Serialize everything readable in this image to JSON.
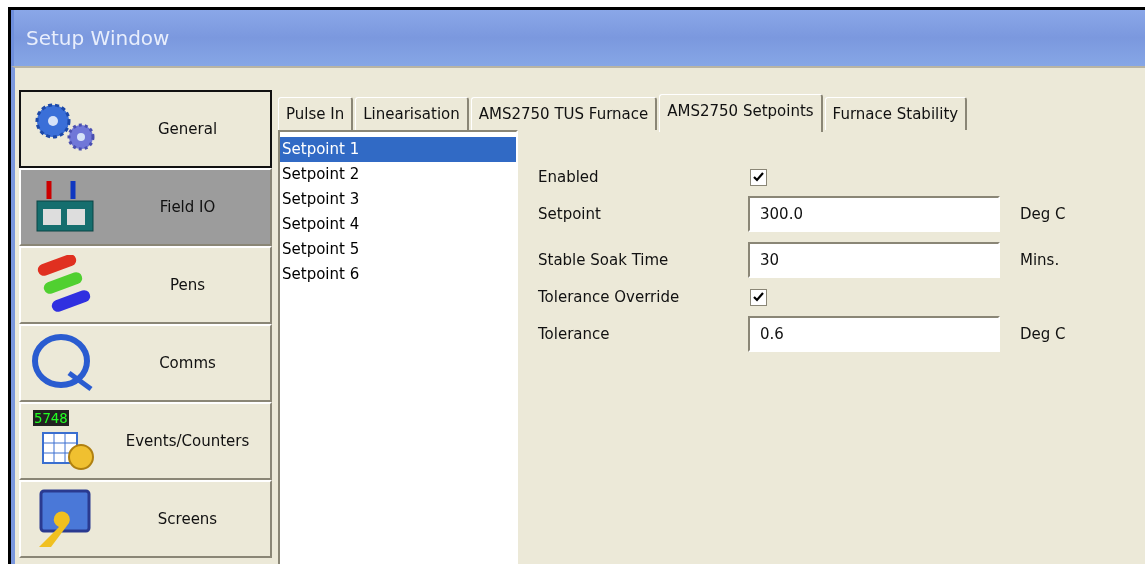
{
  "window": {
    "title": "Setup Window"
  },
  "sidebar": {
    "items": [
      {
        "label": "General",
        "kind": "gears",
        "selected": false,
        "focused": true
      },
      {
        "label": "Field IO",
        "kind": "terminals",
        "selected": true,
        "focused": false
      },
      {
        "label": "Pens",
        "kind": "pens",
        "selected": false,
        "focused": false
      },
      {
        "label": "Comms",
        "kind": "cable",
        "selected": false,
        "focused": false
      },
      {
        "label": "Events/Counters",
        "kind": "counter",
        "badge": "5748",
        "selected": false,
        "focused": false
      },
      {
        "label": "Screens",
        "kind": "monitor",
        "selected": false,
        "focused": false
      }
    ]
  },
  "tabs": [
    {
      "label": "Pulse In",
      "selected": false
    },
    {
      "label": "Linearisation",
      "selected": false
    },
    {
      "label": "AMS2750 TUS Furnace",
      "selected": false
    },
    {
      "label": "AMS2750 Setpoints",
      "selected": true
    },
    {
      "label": "Furnace Stability",
      "selected": false
    }
  ],
  "setpoint_list": [
    {
      "label": "Setpoint 1",
      "selected": true
    },
    {
      "label": "Setpoint 2",
      "selected": false
    },
    {
      "label": "Setpoint 3",
      "selected": false
    },
    {
      "label": "Setpoint 4",
      "selected": false
    },
    {
      "label": "Setpoint 5",
      "selected": false
    },
    {
      "label": "Setpoint 6",
      "selected": false
    }
  ],
  "form": [
    {
      "kind": "checkbox",
      "label": "Enabled",
      "checked": true
    },
    {
      "kind": "input",
      "label": "Setpoint",
      "value": "300.0",
      "unit": "Deg C"
    },
    {
      "kind": "input",
      "label": "Stable Soak Time",
      "value": "30",
      "unit": "Mins."
    },
    {
      "kind": "checkbox",
      "label": "Tolerance Override",
      "checked": true
    },
    {
      "kind": "input",
      "label": "Tolerance",
      "value": "0.6",
      "unit": "Deg C"
    }
  ]
}
